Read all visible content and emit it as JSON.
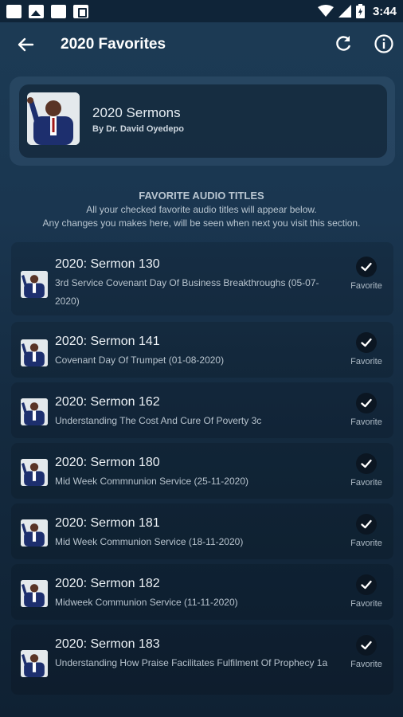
{
  "status_bar": {
    "time": "3:44",
    "icons": [
      "notification-icon",
      "image-icon",
      "notification-icon",
      "sd-card-icon",
      "wifi-icon",
      "signal-icon",
      "battery-icon"
    ]
  },
  "app_bar": {
    "title": "2020 Favorites",
    "back_icon": "arrow-back-icon",
    "refresh_icon": "refresh-icon",
    "info_icon": "info-icon"
  },
  "album": {
    "title": "2020 Sermons",
    "subtitle": "By Dr. David Oyedepo"
  },
  "section": {
    "heading": "FAVORITE AUDIO TITLES",
    "note1": "All your checked favorite audio titles will appear below.",
    "note2": "Any changes you makes here, will be seen when next you visit this section."
  },
  "items": [
    {
      "title": "2020: Sermon 130",
      "desc": "3rd Service Covenant Day Of Business Breakthroughs (05-07-2020)",
      "fav_label": "Favorite"
    },
    {
      "title": "2020: Sermon 141",
      "desc": "Covenant Day Of Trumpet (01-08-2020)",
      "fav_label": "Favorite"
    },
    {
      "title": "2020: Sermon 162",
      "desc": "Understanding The Cost And Cure Of Poverty 3c",
      "fav_label": "Favorite"
    },
    {
      "title": "2020: Sermon 180",
      "desc": "Mid Week Commnunion Service (25-11-2020)",
      "fav_label": "Favorite"
    },
    {
      "title": "2020: Sermon 181",
      "desc": "Mid Week Communion Service (18-11-2020)",
      "fav_label": "Favorite"
    },
    {
      "title": "2020: Sermon 182",
      "desc": "Midweek Communion Service (11-11-2020)",
      "fav_label": "Favorite"
    },
    {
      "title": "2020: Sermon 183",
      "desc": "Understanding How Praise Facilitates Fulfilment Of Prophecy 1a",
      "fav_label": "Favorite"
    }
  ],
  "colors": {
    "background_top": "#1c3b55",
    "background_bottom": "#0f2133",
    "check_circle": "#0b1622",
    "text_primary": "#eef3f7",
    "text_secondary": "#b7c3cd"
  }
}
